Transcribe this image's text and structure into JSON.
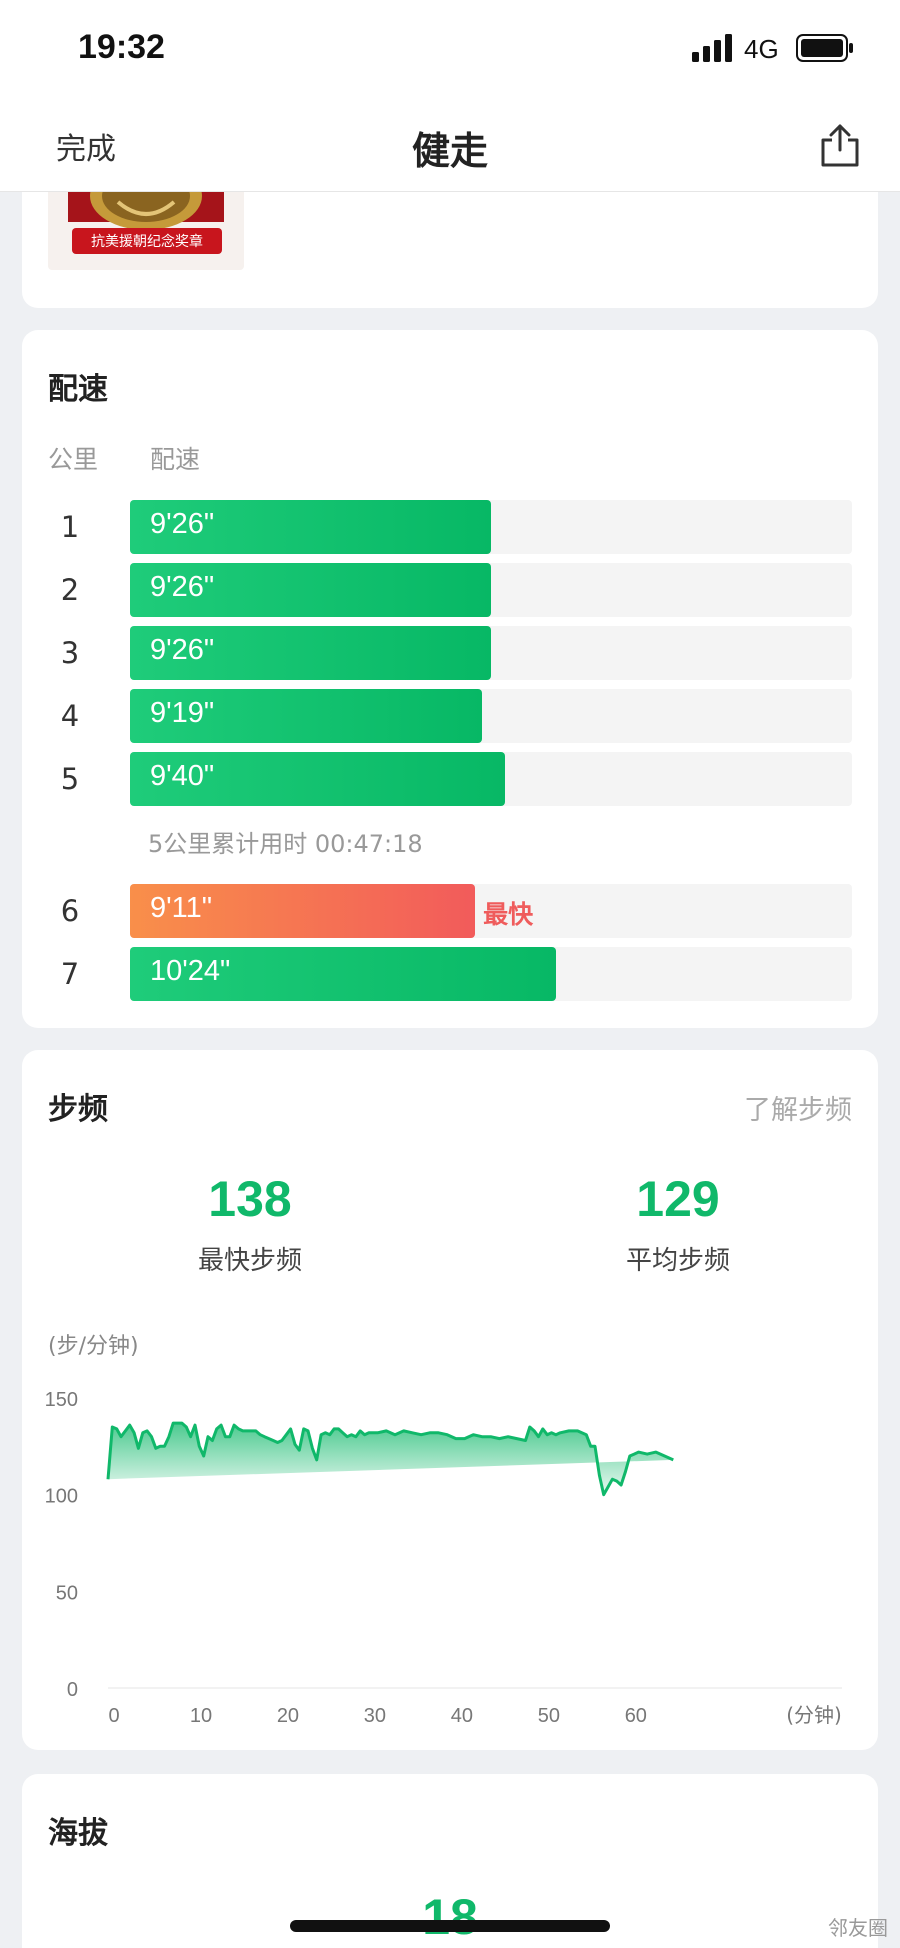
{
  "status": {
    "time": "19:32",
    "network": "4G"
  },
  "nav": {
    "done": "完成",
    "title": "健走",
    "share_icon": "share-icon"
  },
  "medal": {
    "inscription": "抗美援朝纪念奖章",
    "colors": {
      "frame": "#b1191d",
      "gold": "#c59a3a"
    }
  },
  "pace": {
    "title": "配速",
    "col_km": "公里",
    "col_pace": "配速",
    "rows": [
      {
        "km": "1",
        "pace": "9'26\"",
        "fraction": 0.5,
        "fastest": false
      },
      {
        "km": "2",
        "pace": "9'26\"",
        "fraction": 0.5,
        "fastest": false
      },
      {
        "km": "3",
        "pace": "9'26\"",
        "fraction": 0.5,
        "fastest": false
      },
      {
        "km": "4",
        "pace": "9'19\"",
        "fraction": 0.488,
        "fastest": false
      },
      {
        "km": "5",
        "pace": "9'40\"",
        "fraction": 0.52,
        "fastest": false
      },
      {
        "km": "6",
        "pace": "9'11\"",
        "fraction": 0.478,
        "fastest": true
      },
      {
        "km": "7",
        "pace": "10'24\"",
        "fraction": 0.59,
        "fastest": false
      }
    ],
    "cumulative_note": "5公里累计用时 00:47:18",
    "fastest_tag": "最快",
    "colors": {
      "bar": "#07b865",
      "fastest_bar": "#f25b5b",
      "track": "#f4f4f4"
    }
  },
  "cadence": {
    "title": "步频",
    "learn_link": "了解步频",
    "max_value": "138",
    "max_label": "最快步频",
    "avg_value": "129",
    "avg_label": "平均步频",
    "unit": "(步/分钟)",
    "x_unit": "(分钟)"
  },
  "chart_data": {
    "type": "area",
    "xlabel": "(分钟)",
    "ylabel": "(步/分钟)",
    "xlim": [
      0,
      66
    ],
    "ylim": [
      0,
      150
    ],
    "x_ticks": [
      "0",
      "10",
      "20",
      "30",
      "40",
      "50",
      "60"
    ],
    "y_ticks": [
      "0",
      "50",
      "100",
      "150"
    ],
    "grid": false,
    "color": "#10b86a",
    "x": [
      0,
      0.5,
      1,
      1.5,
      2,
      2.5,
      3,
      3.5,
      4,
      4.5,
      5,
      5.5,
      6,
      6.5,
      7,
      7.5,
      8,
      8.5,
      9,
      9.5,
      10,
      10.5,
      11,
      11.5,
      12,
      12.5,
      13,
      13.5,
      14,
      14.5,
      15,
      15.5,
      16,
      16.5,
      17,
      17.5,
      18,
      18.5,
      19,
      19.5,
      20,
      20.5,
      21,
      21.5,
      22,
      22.5,
      23,
      23.5,
      24,
      24.5,
      25,
      25.5,
      26,
      26.5,
      27,
      27.5,
      28,
      28.5,
      29,
      29.5,
      30,
      31,
      32,
      33,
      34,
      35,
      36,
      37,
      38,
      39,
      40,
      41,
      42,
      43,
      44,
      45,
      46,
      47,
      48,
      48.5,
      49,
      49.5,
      50,
      50.5,
      51,
      51.5,
      52,
      53,
      54,
      55,
      55.5,
      56,
      56.5,
      57,
      57.5,
      58,
      58.5,
      59,
      59.5,
      60,
      60.5,
      61,
      62,
      63,
      64,
      65,
      65.5
    ],
    "y": [
      108,
      135,
      134,
      130,
      133,
      136,
      132,
      124,
      132,
      133,
      130,
      124,
      125,
      125,
      130,
      137,
      137,
      137,
      135,
      130,
      136,
      125,
      120,
      130,
      128,
      134,
      136,
      130,
      130,
      136,
      134,
      133,
      133,
      133,
      133,
      131,
      130,
      129,
      128,
      127,
      128,
      131,
      134,
      126,
      123,
      134,
      133,
      124,
      118,
      131,
      132,
      131,
      134,
      134,
      132,
      130,
      131,
      130,
      133,
      131,
      132,
      132,
      133,
      131,
      133,
      132,
      131,
      132,
      132,
      131,
      129,
      129,
      131,
      130,
      130,
      129,
      130,
      129,
      128,
      135,
      133,
      130,
      134,
      131,
      132,
      131,
      132,
      133,
      133,
      131,
      125,
      125,
      110,
      100,
      104,
      108,
      107,
      105,
      112,
      120,
      121,
      122,
      121,
      122,
      120,
      118
    ]
  },
  "altitude": {
    "title": "海拔",
    "value": "18"
  },
  "watermark": "邻友圈"
}
